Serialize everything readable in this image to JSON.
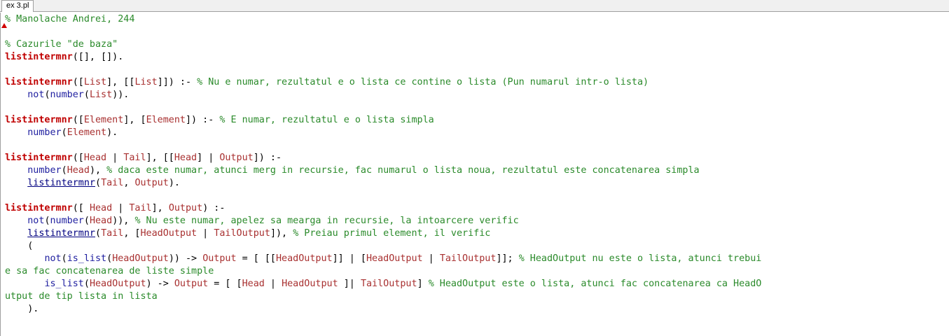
{
  "tab": {
    "title": "ex 3.pl"
  },
  "code_lines": [
    [
      [
        "c",
        "% Manolache Andrei, 244"
      ]
    ],
    [],
    [
      [
        "c",
        "% Cazurile \"de baza\""
      ]
    ],
    [
      [
        "h",
        "listintermnr"
      ],
      [
        "p",
        "([], [])."
      ]
    ],
    [],
    [
      [
        "h",
        "listintermnr"
      ],
      [
        "p",
        "(["
      ],
      [
        "v",
        "List"
      ],
      [
        "p",
        "], [["
      ],
      [
        "v",
        "List"
      ],
      [
        "p",
        "]]) :- "
      ],
      [
        "c",
        "% Nu e numar, rezultatul e o lista ce contine o lista (Pun numarul intr-o lista)"
      ]
    ],
    [
      [
        "p",
        "    "
      ],
      [
        "b",
        "not"
      ],
      [
        "p",
        "("
      ],
      [
        "b",
        "number"
      ],
      [
        "p",
        "("
      ],
      [
        "v",
        "List"
      ],
      [
        "p",
        "))."
      ]
    ],
    [],
    [
      [
        "h",
        "listintermnr"
      ],
      [
        "p",
        "(["
      ],
      [
        "v",
        "Element"
      ],
      [
        "p",
        "], ["
      ],
      [
        "v",
        "Element"
      ],
      [
        "p",
        "]) :- "
      ],
      [
        "c",
        "% E numar, rezultatul e o lista simpla"
      ]
    ],
    [
      [
        "p",
        "    "
      ],
      [
        "b",
        "number"
      ],
      [
        "p",
        "("
      ],
      [
        "v",
        "Element"
      ],
      [
        "p",
        ")."
      ]
    ],
    [],
    [
      [
        "h",
        "listintermnr"
      ],
      [
        "p",
        "(["
      ],
      [
        "v",
        "Head"
      ],
      [
        "p",
        " | "
      ],
      [
        "v",
        "Tail"
      ],
      [
        "p",
        "], [["
      ],
      [
        "v",
        "Head"
      ],
      [
        "p",
        "] | "
      ],
      [
        "v",
        "Output"
      ],
      [
        "p",
        "]) :-"
      ]
    ],
    [
      [
        "p",
        "    "
      ],
      [
        "b",
        "number"
      ],
      [
        "p",
        "("
      ],
      [
        "v",
        "Head"
      ],
      [
        "p",
        "), "
      ],
      [
        "c",
        "% daca este numar, atunci merg in recursie, fac numarul o lista noua, rezultatul este concatenarea simpla"
      ]
    ],
    [
      [
        "p",
        "    "
      ],
      [
        "u",
        "listintermnr"
      ],
      [
        "p",
        "("
      ],
      [
        "v",
        "Tail"
      ],
      [
        "p",
        ", "
      ],
      [
        "v",
        "Output"
      ],
      [
        "p",
        ")."
      ]
    ],
    [],
    [
      [
        "h",
        "listintermnr"
      ],
      [
        "p",
        "([ "
      ],
      [
        "v",
        "Head"
      ],
      [
        "p",
        " | "
      ],
      [
        "v",
        "Tail"
      ],
      [
        "p",
        "], "
      ],
      [
        "v",
        "Output"
      ],
      [
        "p",
        ") :-"
      ]
    ],
    [
      [
        "p",
        "    "
      ],
      [
        "b",
        "not"
      ],
      [
        "p",
        "("
      ],
      [
        "b",
        "number"
      ],
      [
        "p",
        "("
      ],
      [
        "v",
        "Head"
      ],
      [
        "p",
        ")), "
      ],
      [
        "c",
        "% Nu este numar, apelez sa mearga in recursie, la intoarcere verific"
      ]
    ],
    [
      [
        "p",
        "    "
      ],
      [
        "u",
        "listintermnr"
      ],
      [
        "p",
        "("
      ],
      [
        "v",
        "Tail"
      ],
      [
        "p",
        ", ["
      ],
      [
        "v",
        "HeadOutput"
      ],
      [
        "p",
        " | "
      ],
      [
        "v",
        "TailOutput"
      ],
      [
        "p",
        "]), "
      ],
      [
        "c",
        "% Preiau primul element, il verific"
      ]
    ],
    [
      [
        "p",
        "    ("
      ]
    ],
    [
      [
        "p",
        "       "
      ],
      [
        "b",
        "not"
      ],
      [
        "p",
        "("
      ],
      [
        "b",
        "is_list"
      ],
      [
        "p",
        "("
      ],
      [
        "v",
        "HeadOutput"
      ],
      [
        "p",
        ")) -> "
      ],
      [
        "v",
        "Output"
      ],
      [
        "p",
        " = [ [["
      ],
      [
        "v",
        "HeadOutput"
      ],
      [
        "p",
        "]] | ["
      ],
      [
        "v",
        "HeadOutput"
      ],
      [
        "p",
        " | "
      ],
      [
        "v",
        "TailOutput"
      ],
      [
        "p",
        "]]; "
      ],
      [
        "c",
        "% HeadOutput nu este o lista, atunci trebui"
      ]
    ],
    [
      [
        "c",
        "e sa fac concatenarea de liste simple"
      ]
    ],
    [
      [
        "p",
        "       "
      ],
      [
        "b",
        "is_list"
      ],
      [
        "p",
        "("
      ],
      [
        "v",
        "HeadOutput"
      ],
      [
        "p",
        ") -> "
      ],
      [
        "v",
        "Output"
      ],
      [
        "p",
        " = [ ["
      ],
      [
        "v",
        "Head"
      ],
      [
        "p",
        " | "
      ],
      [
        "v",
        "HeadOutput"
      ],
      [
        "p",
        " ]| "
      ],
      [
        "v",
        "TailOutput"
      ],
      [
        "p",
        "] "
      ],
      [
        "c",
        "% HeadOutput este o lista, atunci fac concatenarea ca HeadO"
      ]
    ],
    [
      [
        "c",
        "utput de tip lista in lista"
      ]
    ],
    [
      [
        "p",
        "    )."
      ]
    ]
  ],
  "colors": {
    "comment": "#2a8a2a",
    "head_predicate": "#c00000",
    "builtin": "#2020a0",
    "variable": "#a83030",
    "call": "#000080"
  }
}
